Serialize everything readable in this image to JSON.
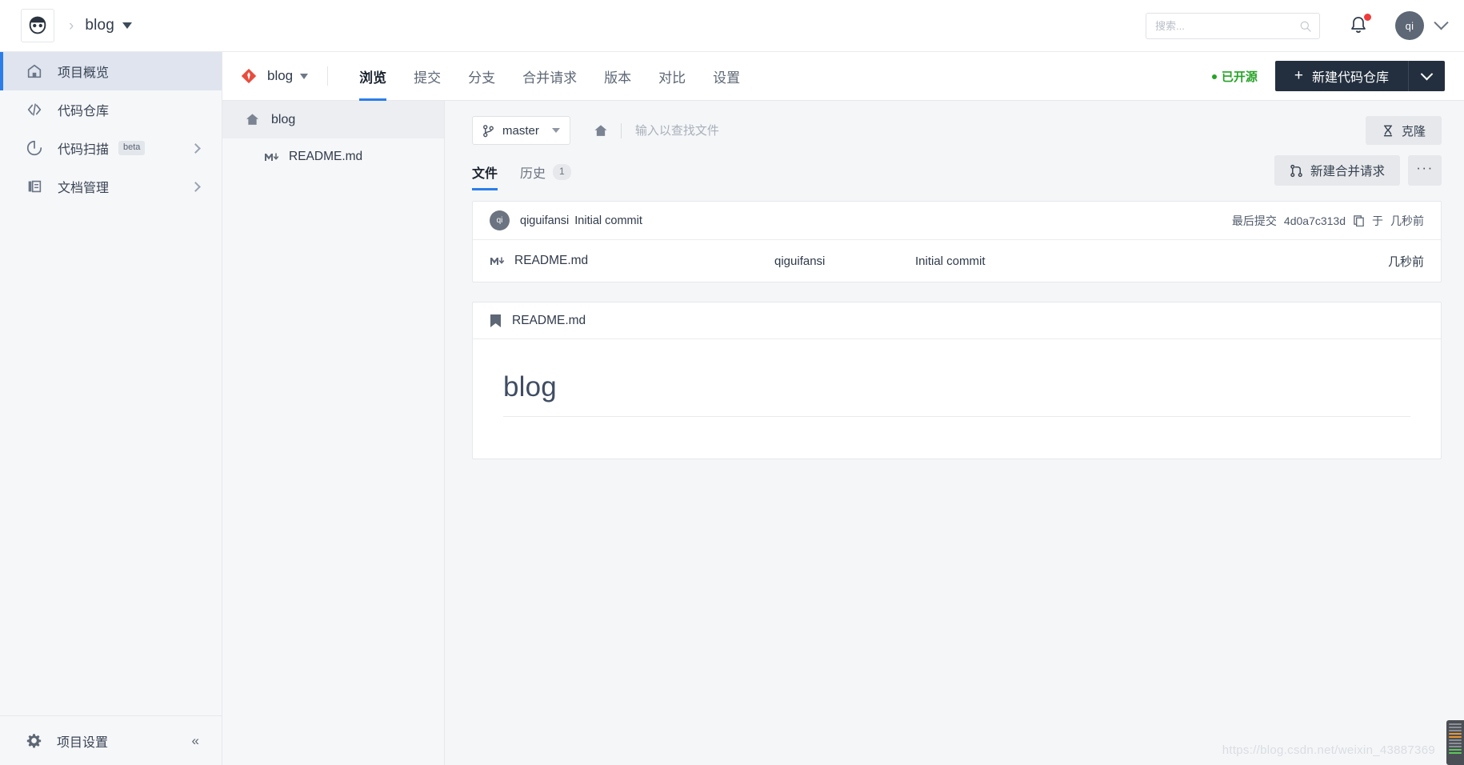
{
  "topbar": {
    "logo_icon": "face-logo-icon",
    "breadcrumb_separator": "›",
    "project_name": "blog",
    "search": {
      "value": "",
      "placeholder": "搜索...",
      "icon": "search-icon"
    },
    "notification_icon": "bell-icon",
    "notification_has_unread": true,
    "user_avatar_initials": "qi",
    "user_menu_icon": "chevron-down-icon"
  },
  "sidebar": {
    "items": [
      {
        "label": "项目概览",
        "icon": "home-icon",
        "active": true,
        "has_chevron": false,
        "badge": ""
      },
      {
        "label": "代码仓库",
        "icon": "code-brackets-icon",
        "active": false,
        "has_chevron": false,
        "badge": ""
      },
      {
        "label": "代码扫描",
        "icon": "scan-icon",
        "active": false,
        "has_chevron": true,
        "badge": "beta"
      },
      {
        "label": "文档管理",
        "icon": "document-icon",
        "active": false,
        "has_chevron": true,
        "badge": ""
      }
    ],
    "footer": {
      "label": "项目设置",
      "icon": "gear-icon",
      "collapse_icon": "double-chevron-left-icon",
      "collapse_glyph": "«"
    }
  },
  "repo_nav": {
    "repo_icon": "git-repo-icon",
    "repo_name": "blog",
    "repo_caret_icon": "caret-down-icon",
    "tabs": [
      {
        "label": "浏览",
        "active": true
      },
      {
        "label": "提交",
        "active": false
      },
      {
        "label": "分支",
        "active": false
      },
      {
        "label": "合并请求",
        "active": false
      },
      {
        "label": "版本",
        "active": false
      },
      {
        "label": "对比",
        "active": false
      },
      {
        "label": "设置",
        "active": false
      }
    ],
    "open_source_badge": "已开源",
    "open_source_color": "#27a327",
    "new_repo_button": "新建代码仓库",
    "new_repo_plus_icon": "plus-icon",
    "new_repo_caret_icon": "chevron-down-icon"
  },
  "tree": {
    "root": {
      "label": "blog",
      "icon": "home-icon"
    },
    "files": [
      {
        "label": "README.md",
        "icon": "markdown-icon"
      }
    ]
  },
  "toolbar": {
    "branch": {
      "name": "master",
      "icon": "branch-icon",
      "caret_icon": "caret-down-icon"
    },
    "path_home_icon": "home-icon",
    "path_input": {
      "value": "",
      "placeholder": "输入以查找文件"
    },
    "clone_button": {
      "label": "克隆",
      "icon": "clone-icon"
    }
  },
  "subtabs": {
    "tabs": [
      {
        "label": "文件",
        "active": true,
        "count": ""
      },
      {
        "label": "历史",
        "active": false,
        "count": "1"
      }
    ],
    "new_mr_button": {
      "label": "新建合并请求",
      "icon": "merge-request-icon"
    },
    "more_button": {
      "label": "···",
      "icon": "ellipsis-icon"
    }
  },
  "commit_bar": {
    "avatar_initials": "qi",
    "author": "qiguifansi",
    "message": "Initial commit",
    "last_commit_label": "最后提交",
    "hash": "4d0a7c313d",
    "copy_icon": "copy-icon",
    "at_label": "于",
    "time": "几秒前"
  },
  "file_list": {
    "rows": [
      {
        "icon": "markdown-icon",
        "name": "README.md",
        "author": "qiguifansi",
        "message": "Initial commit",
        "time": "几秒前"
      }
    ]
  },
  "readme": {
    "header_icon": "book-icon",
    "header_title": "README.md",
    "heading": "blog"
  },
  "watermark": "https://blog.csdn.net/weixin_43887369",
  "colors": {
    "accent_blue": "#2b7de9",
    "dark_button": "#232f3e",
    "open_source_green": "#27a327",
    "notification_red": "#ef3b3b",
    "sidebar_bg": "#f6f7f9",
    "sidebar_active_bg": "#dfe4ef"
  }
}
